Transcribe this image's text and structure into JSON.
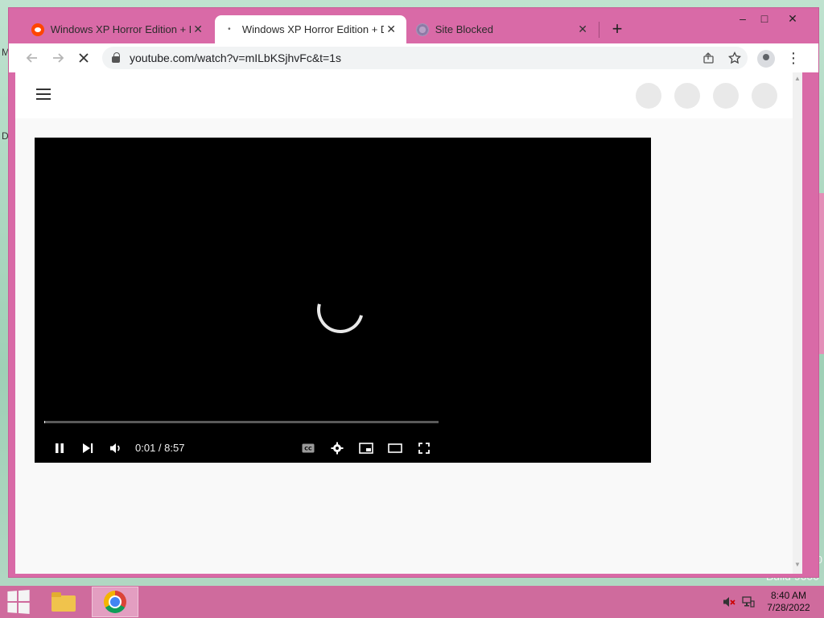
{
  "desktop": {
    "left_labels": [
      "M",
      "D"
    ],
    "build_partial": "Build 9600",
    "build_num": "0"
  },
  "browser": {
    "tabs": [
      {
        "title": "Windows XP Horror Edition + Do",
        "favicon": "reddit-icon",
        "active": false
      },
      {
        "title": "Windows XP Horror Edition + Do",
        "favicon": "loading-dot-icon",
        "active": true
      },
      {
        "title": "Site Blocked",
        "favicon": "globe-icon",
        "active": false
      }
    ],
    "new_tab_label": "+",
    "window_controls": {
      "minimize": "–",
      "maximize": "□",
      "close": "✕"
    },
    "url": "youtube.com/watch?v=mILbKSjhvFc&t=1s"
  },
  "player": {
    "current_time": "0:01",
    "duration": "8:57",
    "time_text": "0:01 / 8:57",
    "progress_fraction": 0.002
  },
  "taskbar": {
    "clock_time": "8:40 AM",
    "clock_date": "7/28/2022"
  },
  "colors": {
    "window_frame": "#d96aa7",
    "taskbar": "#cf6b9d",
    "player_bg": "#000000"
  }
}
